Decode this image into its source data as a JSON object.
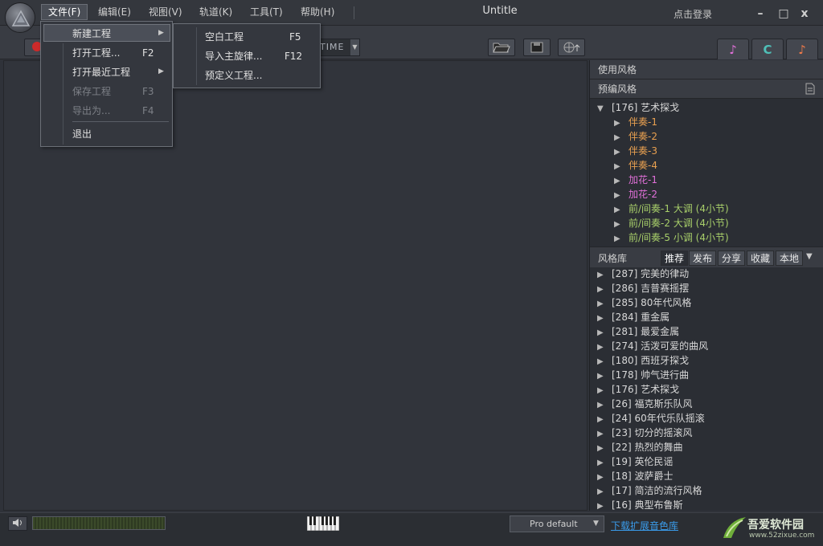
{
  "window": {
    "title": "Untitle",
    "login": "点击登录",
    "min_glyph": "–",
    "max_glyph": "□",
    "close_glyph": "x"
  },
  "menubar": {
    "items": [
      "文件(F)",
      "编辑(E)",
      "视图(V)",
      "轨道(K)",
      "工具(T)",
      "帮助(H)"
    ],
    "active": "文件(F)"
  },
  "file_menu": {
    "items": [
      {
        "label": "新建工程",
        "shortcut": "",
        "submenu": true,
        "highlighted": true
      },
      {
        "label": "打开工程...",
        "shortcut": "F2"
      },
      {
        "label": "打开最近工程",
        "shortcut": "",
        "submenu": true
      },
      {
        "label": "保存工程",
        "shortcut": "F3",
        "disabled": true
      },
      {
        "label": "导出为...",
        "shortcut": "F4",
        "disabled": true
      },
      {
        "label": "退出",
        "shortcut": ""
      }
    ]
  },
  "new_project_submenu": {
    "items": [
      {
        "label": "空白工程",
        "shortcut": "F5"
      },
      {
        "label": "导入主旋律...",
        "shortcut": "F12"
      },
      {
        "label": "预定义工程...",
        "shortcut": ""
      }
    ]
  },
  "toolbar": {
    "time_label": "TIME",
    "icons": [
      "open-folder-icon",
      "save-disk-icon",
      "network-upload-icon"
    ],
    "side_tabs": [
      "music-style-tab",
      "chord-c-tab",
      "notes-tab"
    ],
    "tab_glyphs": [
      "♪",
      "C",
      "♪"
    ]
  },
  "styles_panel": {
    "used_heading": "使用风格",
    "preset_heading": "预编风格",
    "root": "[176] 艺术探戈",
    "children": [
      {
        "label": "伴奏-1",
        "color": "#e8a050"
      },
      {
        "label": "伴奏-2",
        "color": "#e8a050"
      },
      {
        "label": "伴奏-3",
        "color": "#e8a050"
      },
      {
        "label": "伴奏-4",
        "color": "#e8a050"
      },
      {
        "label": "加花-1",
        "color": "#e070d8"
      },
      {
        "label": "加花-2",
        "color": "#e070d8"
      },
      {
        "label": "前/间奏-1 大调 (4小节)",
        "color": "#a8cf6a"
      },
      {
        "label": "前/间奏-2 大调 (4小节)",
        "color": "#a8cf6a"
      },
      {
        "label": "前/间奏-5 小调 (4小节)",
        "color": "#a8cf6a"
      }
    ]
  },
  "library": {
    "heading": "风格库",
    "tabs": [
      "推荐",
      "发布",
      "分享",
      "收藏",
      "本地"
    ],
    "active_tab": "推荐",
    "items": [
      "[287] 完美的律动",
      "[286] 吉普赛摇摆",
      "[285] 80年代风格",
      "[284] 重金属",
      "[281] 最爱金属",
      "[274] 活泼可爱的曲风",
      "[180] 西班牙探戈",
      "[178] 帅气进行曲",
      "[176] 艺术探戈",
      "[26] 福克斯乐队风",
      "[24] 60年代乐队摇滚",
      "[23] 切分的摇滚风",
      "[22] 热烈的舞曲",
      "[19] 英伦民谣",
      "[18] 波萨爵士",
      "[17] 简洁的流行风格",
      "[16] 典型布鲁斯"
    ]
  },
  "statusbar": {
    "preset": "Pro default",
    "download_link": "下载扩展音色库",
    "watermark_name": "吾爱软件园",
    "watermark_url": "www.52zixue.com"
  },
  "colors": {
    "background": "#2f3239",
    "panel": "#2b2e34",
    "accent_link": "#3a9ae8",
    "rec": "#cc2a2a"
  }
}
